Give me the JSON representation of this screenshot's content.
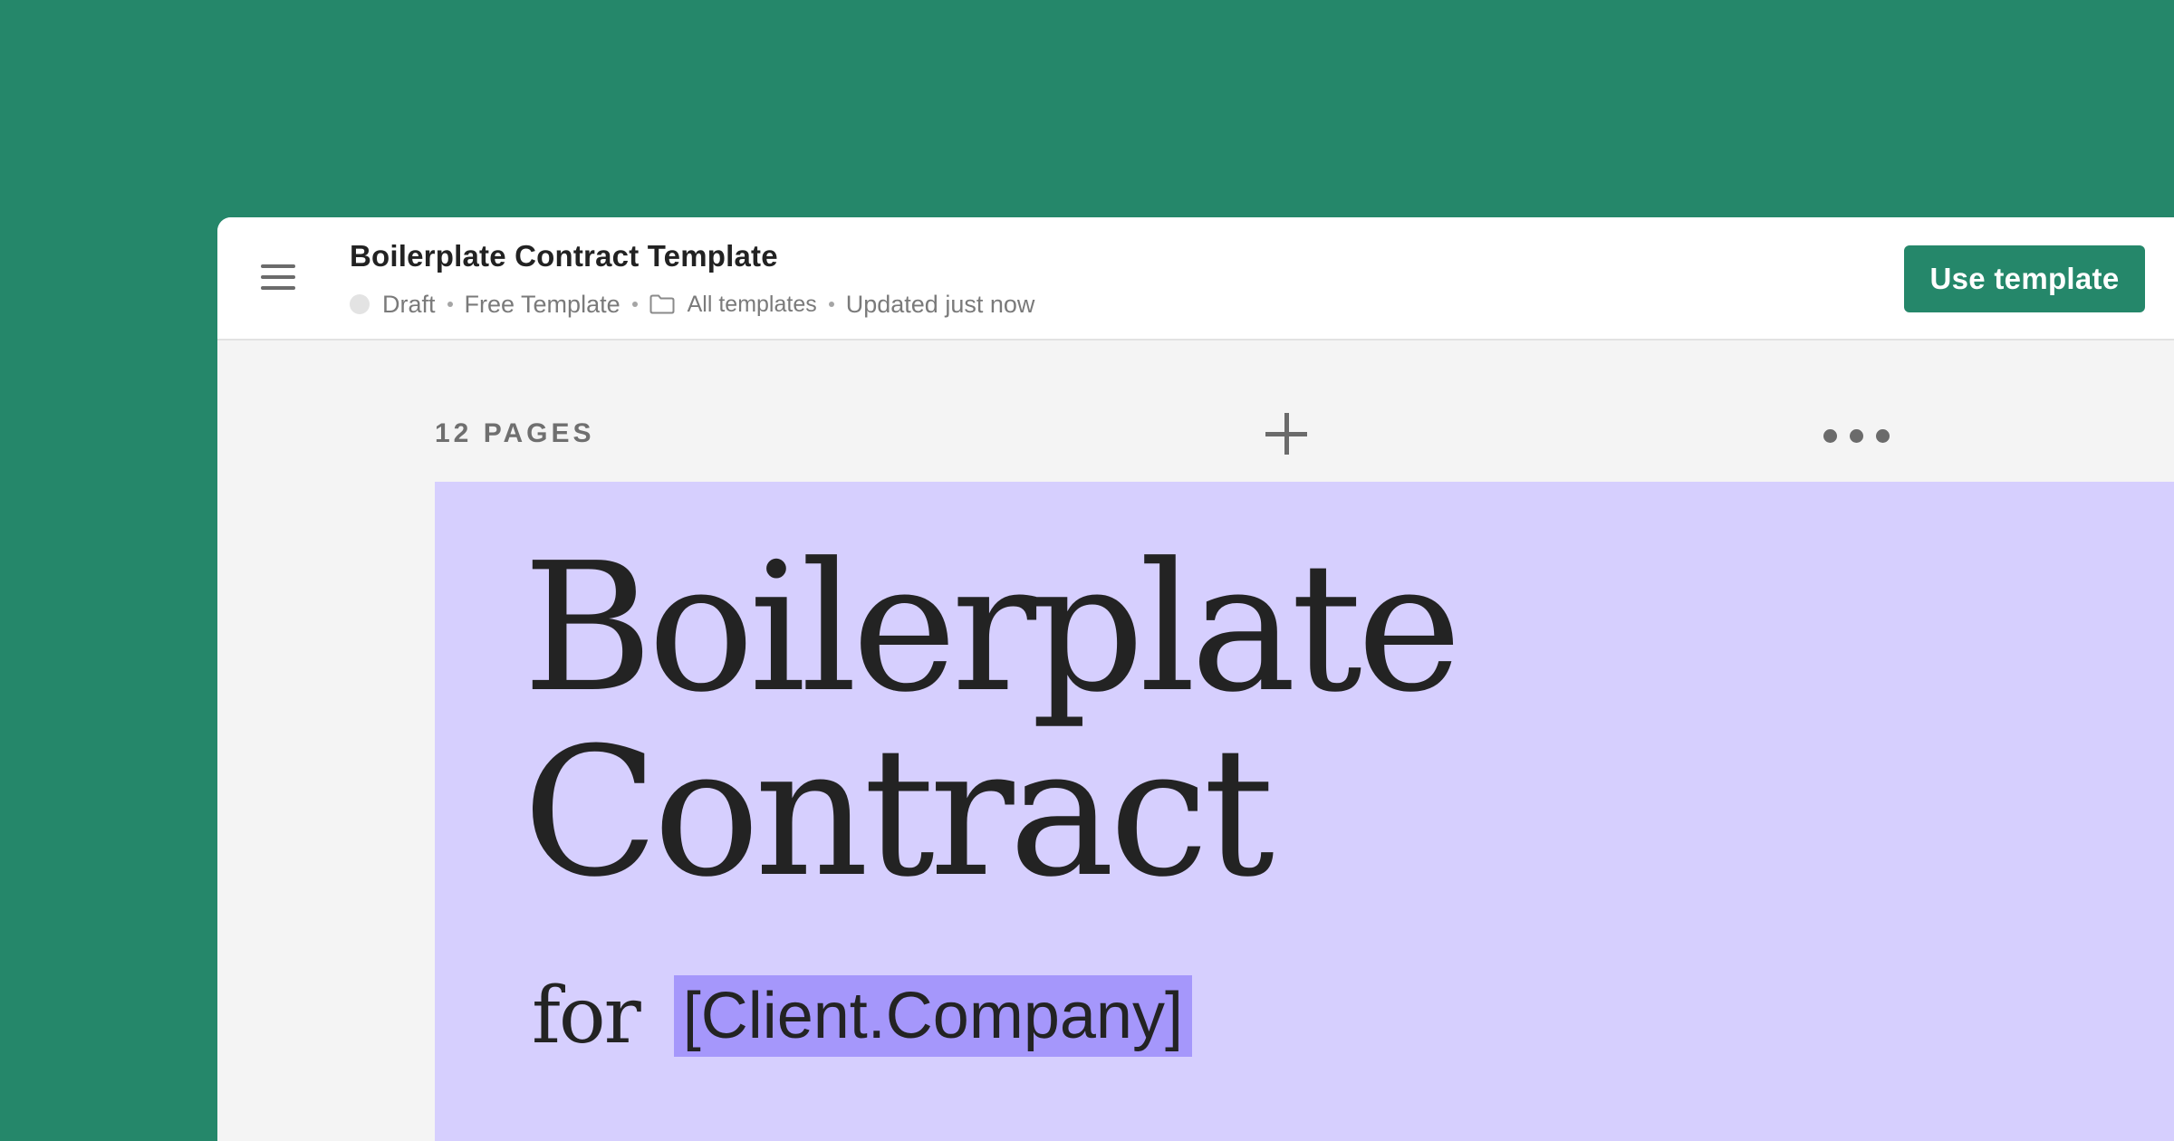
{
  "header": {
    "title": "Boilerplate Contract Template",
    "meta": {
      "status": "Draft",
      "type": "Free Template",
      "folder": "All templates",
      "updated": "Updated just now"
    },
    "use_template_label": "Use template"
  },
  "toolbar": {
    "pages_count": "12 PAGES"
  },
  "cover": {
    "title_line1": "Boilerplate",
    "title_line2": "Contract",
    "for_label": "for",
    "client_placeholder": "[Client.Company]"
  },
  "icons": {
    "menu": "hamburger-menu-icon",
    "folder": "folder-icon",
    "add": "plus-icon",
    "more": "more-dots-icon"
  },
  "colors": {
    "brand_green": "#25876a",
    "page_lavender": "#d6cffe",
    "placeholder_highlight": "#a597fb"
  }
}
